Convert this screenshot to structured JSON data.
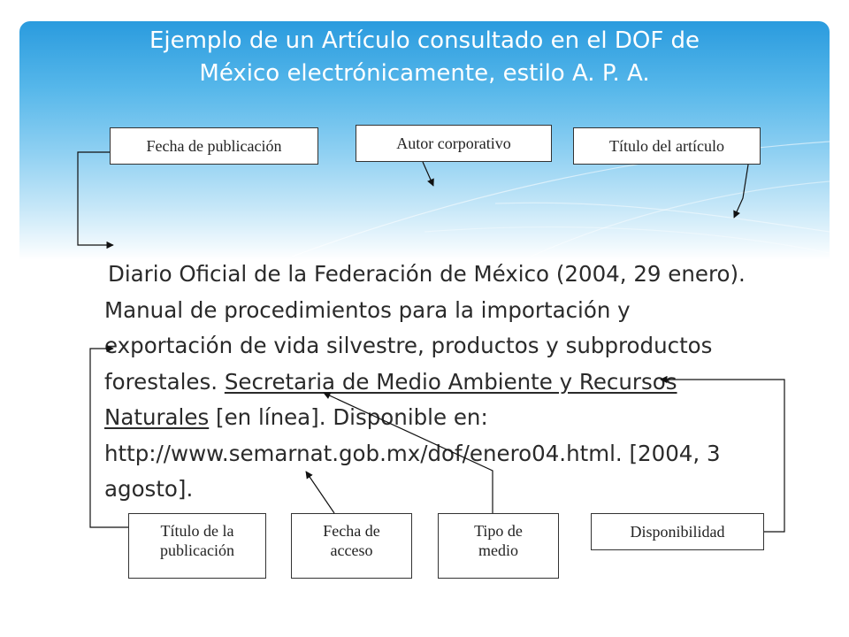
{
  "slide": {
    "title_line1": "Ejemplo de un Artículo consultado en el DOF de",
    "title_line2": "México electrónicamente, estilo A. P. A."
  },
  "labels": {
    "fecha_publicacion": "Fecha de publicación",
    "autor_corporativo": "Autor corporativo",
    "titulo_articulo": "Título del artículo",
    "titulo_publicacion_1": "Título  de la",
    "titulo_publicacion_2": "publicación",
    "fecha_acceso_1": "Fecha de",
    "fecha_acceso_2": "acceso",
    "tipo_medio_1": "Tipo de",
    "tipo_medio_2": "medio",
    "disponibilidad": "Disponibilidad"
  },
  "citation": {
    "part1": "Diario Oficial de la Federación  de México (2004, 29 enero). Manual de procedimientos para la importación y exportación de vida silvestre,  productos y subproductos forestales. ",
    "publication": "Secretaria de Medio Ambiente y Recursos Naturales",
    "part2": " [en línea]. Disponible en: http://www.semarnat.gob.mx/dof/enero04.html. [2004, 3 agosto]."
  },
  "colors": {
    "banner_top": "#2a9bde",
    "title_text": "#ffffff",
    "body_text": "#2a2a2a"
  }
}
